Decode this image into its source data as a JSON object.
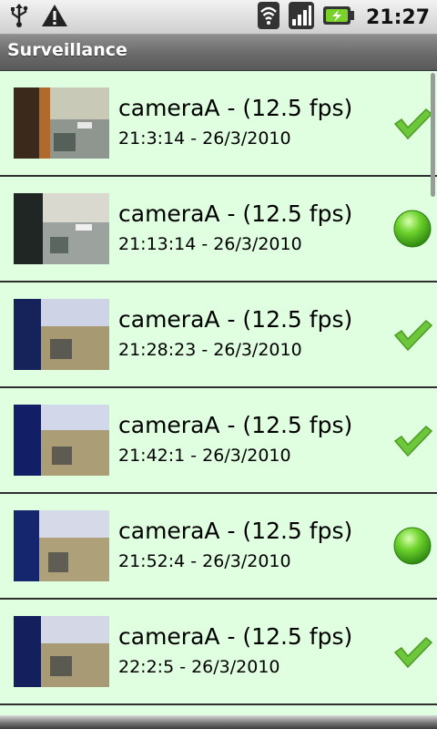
{
  "status_bar": {
    "time": "21:27",
    "icons": [
      "usb-icon",
      "warning-icon",
      "wifi-icon",
      "signal-icon",
      "battery-charging-icon"
    ]
  },
  "title_bar": {
    "title": "Surveillance"
  },
  "colors": {
    "list_background": "#e0ffe0",
    "check_green": "#6cc83a",
    "dot_green": "#5ad12a"
  },
  "captures": [
    {
      "camera": "cameraA - (12.5 fps)",
      "time": "21:3:14 - 26/3/2010",
      "status_icon": "checkmark-icon"
    },
    {
      "camera": "cameraA - (12.5 fps)",
      "time": "21:13:14 - 26/3/2010",
      "status_icon": "green-dot-icon"
    },
    {
      "camera": "cameraA - (12.5 fps)",
      "time": "21:28:23 - 26/3/2010",
      "status_icon": "checkmark-icon"
    },
    {
      "camera": "cameraA - (12.5 fps)",
      "time": "21:42:1 - 26/3/2010",
      "status_icon": "checkmark-icon"
    },
    {
      "camera": "cameraA - (12.5 fps)",
      "time": "21:52:4 - 26/3/2010",
      "status_icon": "green-dot-icon"
    },
    {
      "camera": "cameraA - (12.5 fps)",
      "time": "22:2:5 - 26/3/2010",
      "status_icon": "checkmark-icon"
    }
  ]
}
